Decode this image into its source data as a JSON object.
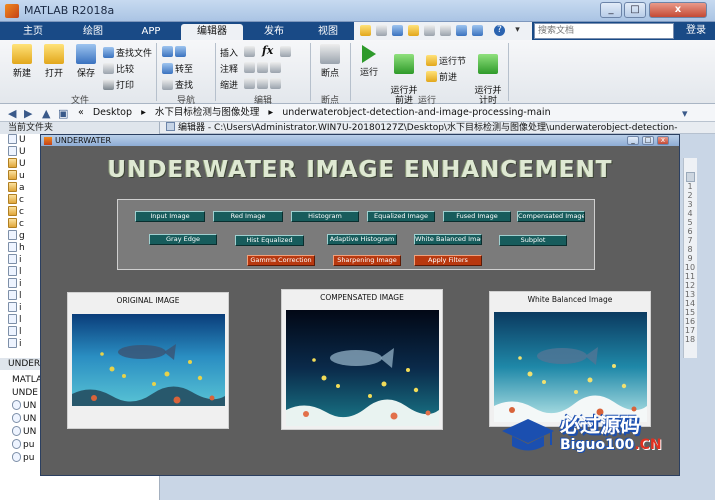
{
  "window": {
    "title": "MATLAB R2018a",
    "min": "_",
    "max": "□",
    "close": "x"
  },
  "tabs": [
    {
      "label": "主页"
    },
    {
      "label": "绘图"
    },
    {
      "label": "APP"
    },
    {
      "label": "编辑器",
      "active": true
    },
    {
      "label": "发布"
    },
    {
      "label": "视图"
    }
  ],
  "quick_access": {
    "help": "?",
    "dropdown": "▾"
  },
  "search": {
    "placeholder": "搜索文档"
  },
  "login": "登录",
  "ribbon": {
    "file": {
      "new": "新建",
      "open": "打开",
      "save": "保存",
      "find_files": "查找文件",
      "compare": "比较",
      "print": "打印",
      "group": "文件"
    },
    "navigate": {
      "goto": "转至",
      "find": "查找",
      "group": "导航"
    },
    "edit": {
      "insert": "插入",
      "comment": "注释",
      "indent": "缩进",
      "fx": "fx",
      "group": "编辑"
    },
    "breakpoints": {
      "label": "断点",
      "group": "断点"
    },
    "run": {
      "run": "运行",
      "run_advance": "运行并\n前进",
      "run_section": "运行节",
      "advance": "前进",
      "run_time": "运行并\n计时",
      "group": "运行"
    }
  },
  "address": {
    "parts": [
      "«",
      "Desktop",
      "▸",
      "水下目标检测与图像处理",
      "▸",
      "underwaterobject-detection-and-image-processing-main"
    ],
    "dropdown": "▾"
  },
  "left_panel": {
    "header": "当前文件夹",
    "files": [
      {
        "label": "U",
        "type": "m"
      },
      {
        "label": "U",
        "type": "m"
      },
      {
        "label": "U",
        "type": "fig"
      },
      {
        "label": "u",
        "type": "fig"
      },
      {
        "label": "a",
        "type": "fig"
      },
      {
        "label": "c",
        "type": "fig"
      },
      {
        "label": "c",
        "type": "fig"
      },
      {
        "label": "c",
        "type": "fig"
      },
      {
        "label": "g",
        "type": "m"
      },
      {
        "label": "h",
        "type": "m"
      },
      {
        "label": "i",
        "type": "m"
      },
      {
        "label": "l",
        "type": "m"
      },
      {
        "label": "i",
        "type": "m"
      },
      {
        "label": "l",
        "type": "m"
      },
      {
        "label": "i",
        "type": "m"
      },
      {
        "label": "l",
        "type": "m"
      },
      {
        "label": "l",
        "type": "m"
      },
      {
        "label": "i",
        "type": "m"
      }
    ],
    "cmd_header": "UNDER",
    "cmd_lines": [
      {
        "text": "MATLAB"
      },
      {
        "text": "UNDE"
      },
      {
        "text": "UN"
      },
      {
        "text": "UN"
      },
      {
        "text": "UN"
      },
      {
        "text": "pu"
      },
      {
        "text": "pu"
      }
    ]
  },
  "editor_bar": {
    "text": "编辑器 - C:\\Users\\Administrator.WIN7U-20180127Z\\Desktop\\水下目标检测与图像处理\\underwaterobject-detection-"
  },
  "line_numbers": [
    "1",
    "2",
    "3",
    "4",
    "5",
    "6",
    "7",
    "8",
    "9",
    "10",
    "11",
    "12",
    "13",
    "14",
    "15",
    "16",
    "17",
    "18"
  ],
  "figure": {
    "title": "UNDERWATER",
    "headline": "UNDERWATER IMAGE ENHANCEMENT",
    "buttons_row1": [
      "Input Image",
      "Red Image",
      "Histogram",
      "Equalized Image",
      "Fused Image",
      "Compensated Image"
    ],
    "buttons_row2": [
      "Gray Edge",
      "Hist Equalized",
      "Adaptive Histogram",
      "White Balanced Image",
      "Subplot"
    ],
    "buttons_row3": [
      "Gamma Correction",
      "Sharpening Image",
      "Apply Filters"
    ],
    "cards": [
      {
        "caption": "ORIGINAL IMAGE"
      },
      {
        "caption": "COMPENSATED IMAGE"
      },
      {
        "caption": "White Balanced Image"
      }
    ]
  },
  "watermark": {
    "cn": "必过源码",
    "en_main": "Biguo100",
    "en_tld": ".CN"
  },
  "colors": {
    "tabbar": "#194a86",
    "figure_bg": "#5e5e5e",
    "ui_button": "#175c5c",
    "ui_button_alt": "#b8380f"
  }
}
